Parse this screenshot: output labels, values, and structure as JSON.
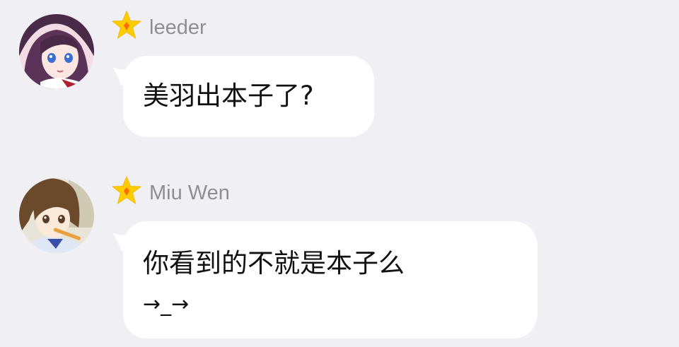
{
  "messages": [
    {
      "sender": "leeder",
      "avatar_icon": "anime-girl-purple-hair-avatar",
      "badge_icon": "star-badge-icon",
      "text_lines": [
        "美羽出本子了?"
      ]
    },
    {
      "sender": "Miu Wen",
      "avatar_icon": "anime-girl-brown-hair-avatar",
      "badge_icon": "star-badge-icon",
      "text_lines": [
        "你看到的不就是本子么",
        "→_→"
      ]
    }
  ],
  "colors": {
    "background": "#efeff4",
    "bubble": "#ffffff",
    "sender_text": "#8e8e93",
    "message_text": "#111111",
    "star_fill": "#ffcc00",
    "star_center": "#ff6a00"
  }
}
